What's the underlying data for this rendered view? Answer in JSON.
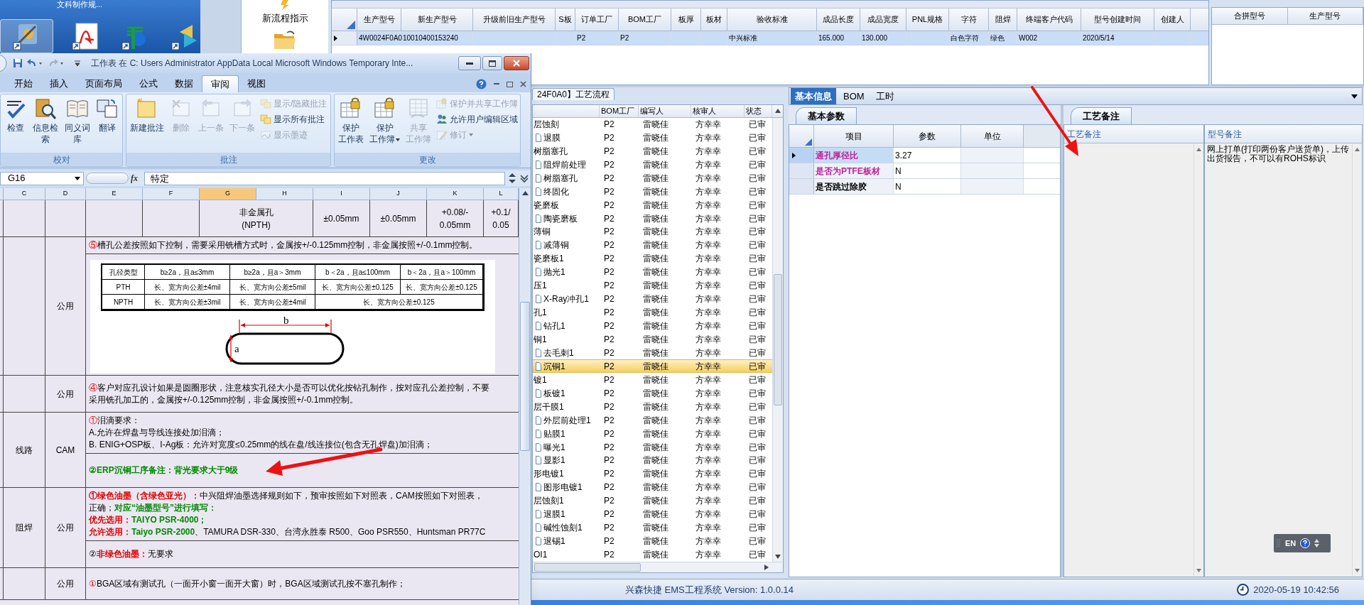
{
  "desktop": {
    "caption": "文科制作规...",
    "icons": [
      {
        "kind": "tools",
        "selected": true
      },
      {
        "kind": "pdf",
        "selected": false
      },
      {
        "kind": "p-app",
        "selected": false
      },
      {
        "kind": "arrows",
        "selected": false
      }
    ]
  },
  "app": {
    "flow_button": "新流程指示",
    "product_grid": {
      "columns": [
        "生产型号",
        "新生产型号",
        "升级前旧生产型号",
        "S板",
        "订单工厂",
        "BOM工厂",
        "板厚",
        "板材",
        "验收标准",
        "成品长度",
        "成品宽度",
        "PNL规格",
        "字符",
        "阻焊",
        "终端客户代码",
        "型号创建时间",
        "创建人"
      ],
      "rows": [
        {
          "selected": true,
          "cells": [
            "4W0024F0A0",
            "10010400153240",
            null,
            null,
            "P2",
            "P2",
            null,
            null,
            "中兴标准",
            "165.000",
            "130.000",
            null,
            "白色字符",
            "绿色",
            "W002",
            "2020/5/14",
            null
          ]
        }
      ]
    },
    "merge_grid": {
      "columns": [
        "合拼型号",
        "生产型号"
      ]
    },
    "process": {
      "tab": "24F0A0】工艺流程",
      "columns": [
        "BOM工厂",
        "编写人",
        "核审人",
        "状态"
      ],
      "nodes": [
        {
          "name": "层蚀刻",
          "bom": "P2",
          "writer": "雷晓佳",
          "reviewer": "方幸幸",
          "status": "已审",
          "selected": false,
          "children": [
            {
              "name": "退膜",
              "bom": "P2",
              "writer": "雷晓佳",
              "reviewer": "方幸幸",
              "status": "已审",
              "selected": false
            }
          ]
        },
        {
          "name": "树脂塞孔",
          "bom": "P2",
          "writer": "雷晓佳",
          "reviewer": "方幸幸",
          "status": "已审",
          "selected": false,
          "children": [
            {
              "name": "阻焊前处理",
              "bom": "P2",
              "writer": "雷晓佳",
              "reviewer": "方幸幸",
              "status": "已审",
              "selected": false
            },
            {
              "name": "树脂塞孔",
              "bom": "P2",
              "writer": "雷晓佳",
              "reviewer": "方幸幸",
              "status": "已审",
              "selected": false
            },
            {
              "name": "终固化",
              "bom": "P2",
              "writer": "雷晓佳",
              "reviewer": "方幸幸",
              "status": "已审",
              "selected": false
            }
          ]
        },
        {
          "name": "瓷磨板",
          "bom": "P2",
          "writer": "雷晓佳",
          "reviewer": "方幸幸",
          "status": "已审",
          "selected": false,
          "children": [
            {
              "name": "陶瓷磨板",
              "bom": "P2",
              "writer": "雷晓佳",
              "reviewer": "方幸幸",
              "status": "已审",
              "selected": false
            }
          ]
        },
        {
          "name": "薄铜",
          "bom": "P2",
          "writer": "雷晓佳",
          "reviewer": "方幸幸",
          "status": "已审",
          "selected": false,
          "children": [
            {
              "name": "减薄铜",
              "bom": "P2",
              "writer": "雷晓佳",
              "reviewer": "方幸幸",
              "status": "已审",
              "selected": false
            }
          ]
        },
        {
          "name": "瓷磨板1",
          "bom": "P2",
          "writer": "雷晓佳",
          "reviewer": "方幸幸",
          "status": "已审",
          "selected": false,
          "children": [
            {
              "name": "抛光1",
              "bom": "P2",
              "writer": "雷晓佳",
              "reviewer": "方幸幸",
              "status": "已审",
              "selected": false
            }
          ]
        },
        {
          "name": "压1",
          "bom": "P2",
          "writer": "雷晓佳",
          "reviewer": "方幸幸",
          "status": "已审",
          "selected": false,
          "children": [
            {
              "name": "X-Ray冲孔1",
              "bom": "P2",
              "writer": "雷晓佳",
              "reviewer": "方幸幸",
              "status": "已审",
              "selected": false
            }
          ]
        },
        {
          "name": "孔1",
          "bom": "P2",
          "writer": "雷晓佳",
          "reviewer": "方幸幸",
          "status": "已审",
          "selected": false,
          "children": [
            {
              "name": "钻孔1",
              "bom": "P2",
              "writer": "雷晓佳",
              "reviewer": "方幸幸",
              "status": "已审",
              "selected": false
            }
          ]
        },
        {
          "name": "铜1",
          "bom": "P2",
          "writer": "雷晓佳",
          "reviewer": "方幸幸",
          "status": "已审",
          "selected": false,
          "children": [
            {
              "name": "去毛刺1",
              "bom": "P2",
              "writer": "雷晓佳",
              "reviewer": "方幸幸",
              "status": "已审",
              "selected": false
            },
            {
              "name": "沉铜1",
              "bom": "P2",
              "writer": "雷晓佳",
              "reviewer": "方幸幸",
              "status": "已审",
              "selected": true
            }
          ]
        },
        {
          "name": "镀1",
          "bom": "P2",
          "writer": "雷晓佳",
          "reviewer": "方幸幸",
          "status": "已审",
          "selected": false,
          "children": [
            {
              "name": "板镀1",
              "bom": "P2",
              "writer": "雷晓佳",
              "reviewer": "方幸幸",
              "status": "已审",
              "selected": false
            }
          ]
        },
        {
          "name": "层干膜1",
          "bom": "P2",
          "writer": "雷晓佳",
          "reviewer": "方幸幸",
          "status": "已审",
          "selected": false,
          "children": [
            {
              "name": "外层前处理1",
              "bom": "P2",
              "writer": "雷晓佳",
              "reviewer": "方幸幸",
              "status": "已审",
              "selected": false
            },
            {
              "name": "贴膜1",
              "bom": "P2",
              "writer": "雷晓佳",
              "reviewer": "方幸幸",
              "status": "已审",
              "selected": false
            },
            {
              "name": "曝光1",
              "bom": "P2",
              "writer": "雷晓佳",
              "reviewer": "方幸幸",
              "status": "已审",
              "selected": false
            },
            {
              "name": "显影1",
              "bom": "P2",
              "writer": "雷晓佳",
              "reviewer": "方幸幸",
              "status": "已审",
              "selected": false
            }
          ]
        },
        {
          "name": "形电镀1",
          "bom": "P2",
          "writer": "雷晓佳",
          "reviewer": "方幸幸",
          "status": "已审",
          "selected": false,
          "children": [
            {
              "name": "图形电镀1",
              "bom": "P2",
              "writer": "雷晓佳",
              "reviewer": "方幸幸",
              "status": "已审",
              "selected": false
            }
          ]
        },
        {
          "name": "层蚀刻1",
          "bom": "P2",
          "writer": "雷晓佳",
          "reviewer": "方幸幸",
          "status": "已审",
          "selected": false,
          "children": [
            {
              "name": "退膜1",
              "bom": "P2",
              "writer": "雷晓佳",
              "reviewer": "方幸幸",
              "status": "已审",
              "selected": false
            },
            {
              "name": "碱性蚀刻1",
              "bom": "P2",
              "writer": "雷晓佳",
              "reviewer": "方幸幸",
              "status": "已审",
              "selected": false
            },
            {
              "name": "退锡1",
              "bom": "P2",
              "writer": "雷晓佳",
              "reviewer": "方幸幸",
              "status": "已审",
              "selected": false
            }
          ]
        },
        {
          "name": "OI1",
          "bom": "P2",
          "writer": "雷晓佳",
          "reviewer": "方幸幸",
          "status": "已审",
          "selected": false
        }
      ]
    },
    "detail": {
      "tabs": [
        {
          "label": "基本信息",
          "selected": true
        },
        {
          "label": "BOM",
          "selected": false
        },
        {
          "label": "工时",
          "selected": false
        }
      ],
      "params": {
        "tab": "基本参数",
        "columns": [
          "项目",
          "参数",
          "单位"
        ],
        "rows": [
          {
            "item": "通孔厚径比",
            "color": "#c0209a",
            "value": "3.27",
            "selected": true
          },
          {
            "item": "是否为PTFE板材",
            "color": "#c0209a",
            "value": "N",
            "selected": false
          },
          {
            "item": "是否跳过除胶",
            "color": "#000000",
            "value": "N",
            "selected": false
          }
        ]
      },
      "notes": {
        "tab": "工艺备注",
        "columns": [
          "工艺备注",
          "型号备注"
        ],
        "model_note": "网上打单(打印两份客户送货单)，上传出货报告，不可以有ROHS标识"
      },
      "language_bar": "EN"
    },
    "status_bar": {
      "version": "兴森快捷 EMS工程系统 Version: 1.0.0.14",
      "time": "2020-05-19 10:42:56"
    }
  },
  "excel": {
    "title": "工作表 在 C: Users Administrator AppData Local Microsoft Windows Temporary Inte...",
    "tabs": [
      {
        "label": "开始",
        "selected": false
      },
      {
        "label": "插入",
        "selected": false
      },
      {
        "label": "页面布局",
        "selected": false
      },
      {
        "label": "公式",
        "selected": false
      },
      {
        "label": "数据",
        "selected": false
      },
      {
        "label": "审阅",
        "selected": true
      },
      {
        "label": "视图",
        "selected": false
      }
    ],
    "groups": [
      {
        "label": "校对",
        "buttons": [
          {
            "kind": "large",
            "label": "检查",
            "disabled": false,
            "dropdown": false
          },
          {
            "kind": "large",
            "label": "信息检索",
            "disabled": false,
            "dropdown": false
          },
          {
            "kind": "large",
            "label": "同义词库",
            "disabled": false,
            "dropdown": false
          },
          {
            "kind": "large",
            "label": "翻译",
            "disabled": false,
            "dropdown": false
          }
        ]
      },
      {
        "label": "批注",
        "buttons": [
          {
            "kind": "large",
            "label": "新建批注",
            "disabled": false,
            "dropdown": false
          },
          {
            "kind": "large",
            "label": "删除",
            "disabled": true,
            "dropdown": false
          },
          {
            "kind": "large",
            "label": "上一条",
            "disabled": true,
            "dropdown": false
          },
          {
            "kind": "large",
            "label": "下一条",
            "disabled": true,
            "dropdown": false
          },
          {
            "kind": "small",
            "label": "显示/隐藏批注",
            "disabled": true,
            "dropdown": false
          },
          {
            "kind": "small",
            "label": "显示所有批注",
            "disabled": false,
            "dropdown": false
          },
          {
            "kind": "small",
            "label": "显示墨迹",
            "disabled": true,
            "dropdown": false
          }
        ]
      },
      {
        "label": "更改",
        "buttons": [
          {
            "kind": "large",
            "label": "保护",
            "label_2": "工作表",
            "disabled": false,
            "dropdown": false
          },
          {
            "kind": "large",
            "label": "保护",
            "label_2": "工作簿",
            "disabled": false,
            "dropdown": true
          },
          {
            "kind": "large",
            "label": "共享",
            "label_2": "工作簿",
            "disabled": true,
            "dropdown": false
          },
          {
            "kind": "small",
            "label": "保护并共享工作簿",
            "disabled": true,
            "dropdown": false
          },
          {
            "kind": "small",
            "label": "允许用户编辑区域",
            "disabled": false,
            "dropdown": false
          },
          {
            "kind": "small",
            "label": "修订",
            "disabled": true,
            "dropdown": true
          }
        ]
      }
    ],
    "name_box": "G16",
    "function_label": "fx",
    "formula": "特定",
    "columns": [
      {
        "label": "C",
        "selected": false
      },
      {
        "label": "D",
        "selected": false
      },
      {
        "label": "E",
        "selected": false
      },
      {
        "label": "F",
        "selected": false
      },
      {
        "label": "G",
        "selected": true
      },
      {
        "label": "H",
        "selected": false
      },
      {
        "label": "I",
        "selected": false
      },
      {
        "label": "J",
        "selected": false
      },
      {
        "label": "K",
        "selected": false
      },
      {
        "label": "L",
        "selected": false
      }
    ],
    "rows": [
      {
        "kind": "tolerance",
        "cells": [
          "非金属孔\n(NPTH)",
          "±0.05mm",
          "±0.05mm",
          "+0.08/-\n0.05mm",
          "+0.1/\n0.05"
        ]
      },
      {
        "kind": "note",
        "scope": "公用",
        "blocks": [
          {
            "kind": "text",
            "lines": [
              [
                {
                  "kind": "red",
                  "text": "⑤"
                },
                {
                  "kind": "plain",
                  "text": "槽孔公差按照如下控制，需要采用铣槽方式时，金属按+/-0.125mm控制，非金属按照+/-0.1mm控制。"
                }
              ]
            ]
          },
          {
            "kind": "figure",
            "header": [
              "孔径类型",
              "b≥2a，且a≤3mm",
              "b≥2a，且a＞3mm",
              "b＜2a，且a≤100mm",
              "b＜2a，且a＞100mm"
            ],
            "rows": [
              [
                "PTH",
                "长、宽方向公差±4mil",
                "长、宽方向公差±5mil",
                "长、宽方向公差±0.125",
                "长、宽方向公差±0.125"
              ],
              [
                "NPTH",
                "长、宽方向公差±3mil",
                "长、宽方向公差±4mil",
                "长、宽方向公差±0.125"
              ]
            ],
            "length_label": "b",
            "width_label": "a"
          }
        ]
      },
      {
        "kind": "note",
        "scope": "公用",
        "blocks": [
          {
            "kind": "text",
            "lines": [
              [
                {
                  "kind": "red",
                  "text": "④"
                },
                {
                  "kind": "plain",
                  "text": "客户对应孔设计如果是圆圈形状，注意核实孔径大小是否可以优化按钻孔制作，按对应孔公差控制，不要"
                }
              ],
              [
                {
                  "kind": "plain",
                  "text": "采用铣孔加工的，金属按+/-0.125mm控制，非金属按照+/-0.1mm控制。"
                }
              ]
            ]
          }
        ]
      },
      {
        "kind": "note",
        "category": "线路",
        "scope": "CAM",
        "blocks": [
          {
            "kind": "text",
            "lines": [
              [
                {
                  "kind": "red",
                  "text": "①"
                },
                {
                  "kind": "plain",
                  "text": "泪滴要求："
                }
              ],
              [
                {
                  "kind": "plain",
                  "text": "A.允许在焊盘与导线连接处加泪滴；"
                }
              ],
              [
                {
                  "kind": "plain",
                  "text": "B.  ENIG+OSP板、I-Ag板：允许对宽度≤0.25mm的线在盘/线连接位(包含无孔焊盘)加泪滴；"
                }
              ]
            ]
          },
          {
            "kind": "text",
            "lines": [
              [
                {
                  "kind": "green-bold",
                  "text": "②ERP沉铜工序备注：背光要求大于9级"
                }
              ]
            ]
          }
        ]
      },
      {
        "kind": "note",
        "category": "阻焊",
        "scope": "公用",
        "blocks": [
          {
            "kind": "text",
            "lines": [
              [
                {
                  "kind": "red-bold",
                  "text": "①绿色油墨（含绿色亚光）："
                },
                {
                  "kind": "plain",
                  "text": "中兴阻焊油墨选择规则如下，预审按照如下对照表，CAM按照如下对照表，"
                }
              ],
              [
                {
                  "kind": "plain",
                  "text": "正确；"
                },
                {
                  "kind": "green-bold",
                  "text": "对应“油墨型号”进行填写："
                }
              ],
              [
                {
                  "kind": "red-bold",
                  "text": "优先选用："
                },
                {
                  "kind": "green-bold",
                  "text": "TAIYO PSR-4000；"
                }
              ],
              [
                {
                  "kind": "red-bold",
                  "text": "允许选用："
                },
                {
                  "kind": "green-bold",
                  "text": "Taiyo PSR-2000"
                },
                {
                  "kind": "plain",
                  "text": "、TAMURA DSR-330、台湾永胜泰 R500、Goo PSR550、Huntsman PR77C"
                }
              ]
            ]
          },
          {
            "kind": "text",
            "lines": [
              [
                {
                  "kind": "plain",
                  "text": "②"
                },
                {
                  "kind": "red-bold",
                  "text": "非绿色油墨："
                },
                {
                  "kind": "plain",
                  "text": "无要求"
                }
              ]
            ]
          }
        ]
      },
      {
        "kind": "note",
        "scope": "公用",
        "blocks": [
          {
            "kind": "text",
            "lines": [
              [
                {
                  "kind": "red",
                  "text": "①"
                },
                {
                  "kind": "plain",
                  "text": "BGA区域有测试孔（一面开小窗一面开大窗）时，BGA区域测试孔按不塞孔制作；"
                }
              ]
            ]
          }
        ]
      }
    ]
  }
}
